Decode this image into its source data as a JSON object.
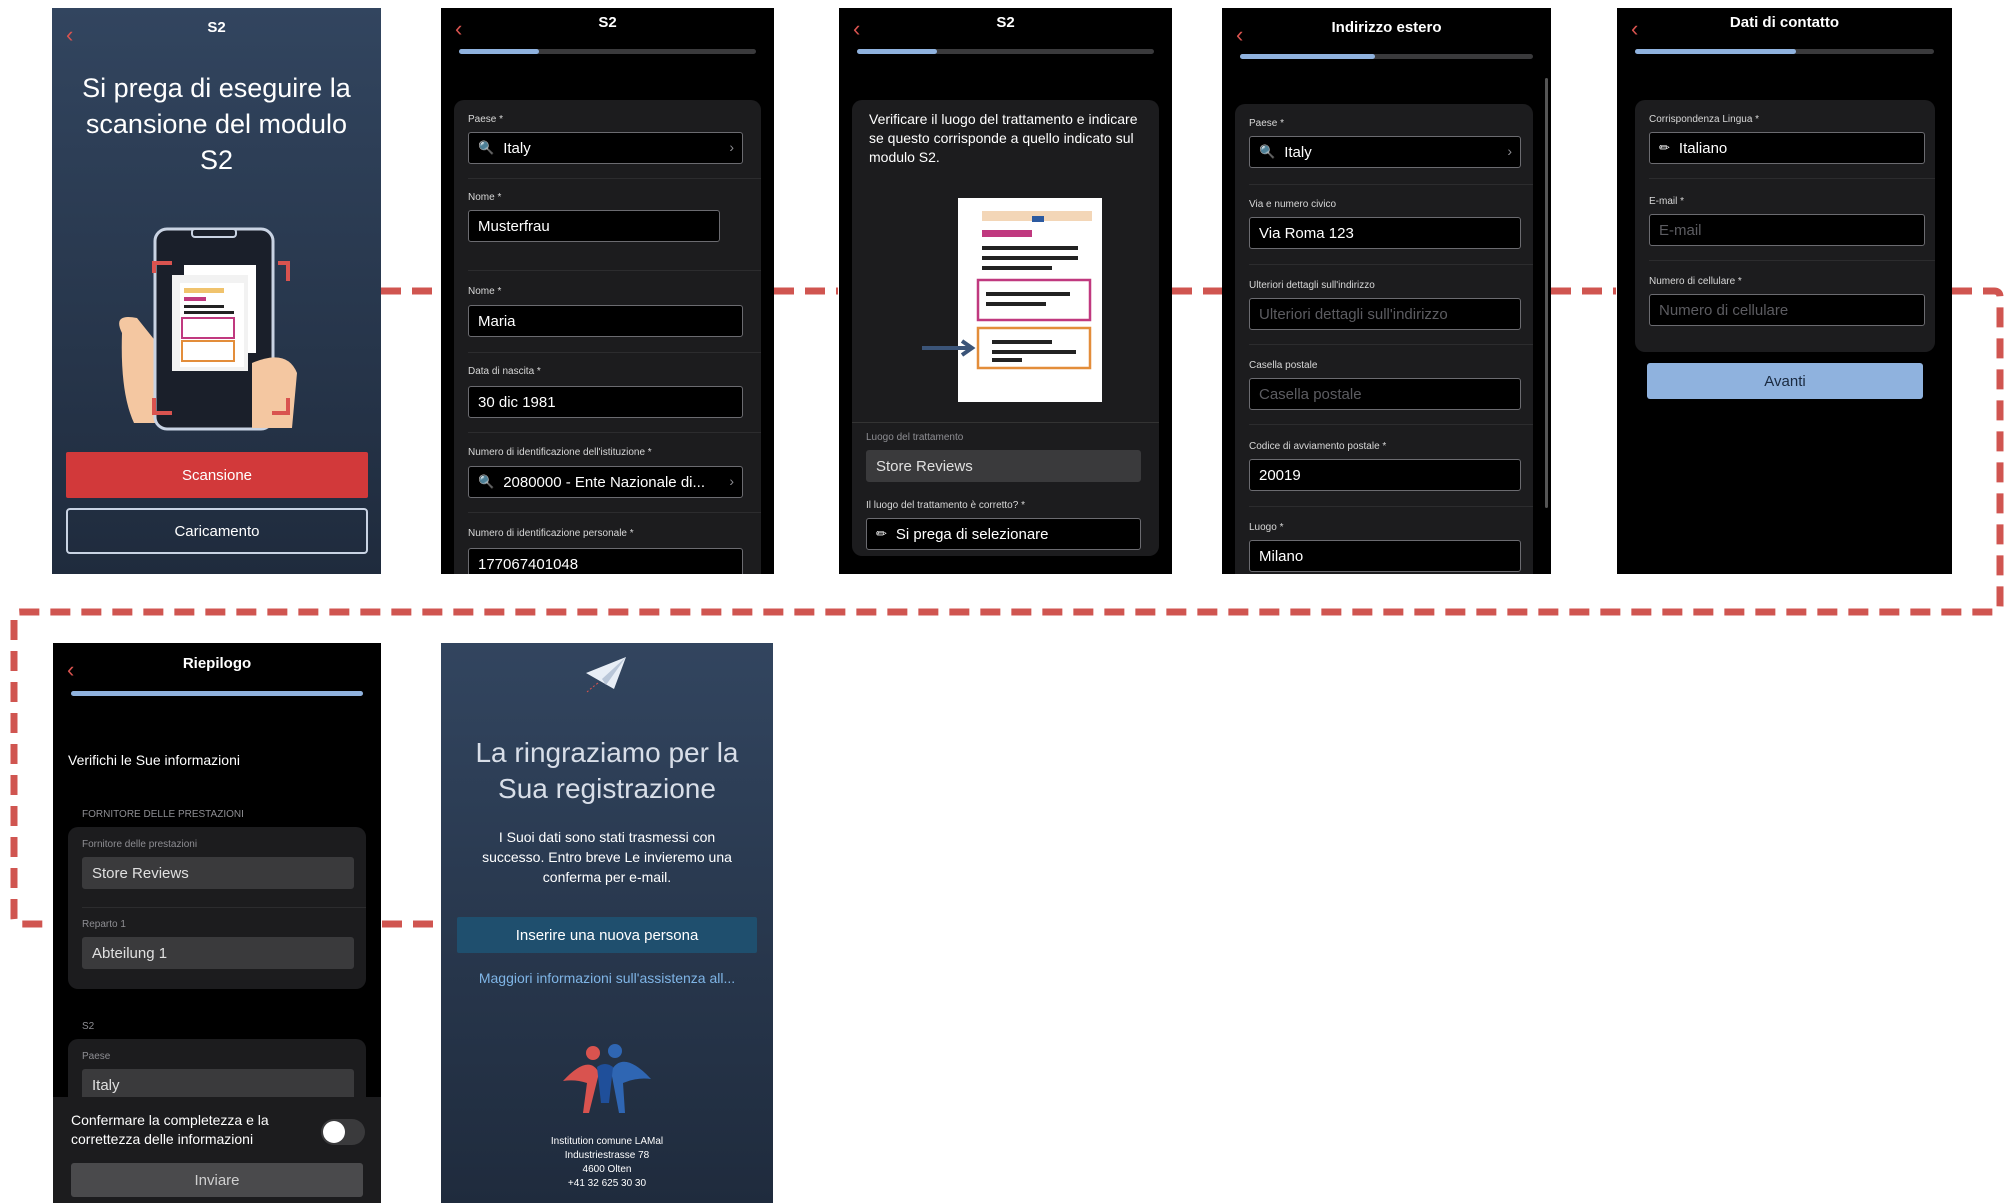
{
  "scan": {
    "title": "S2",
    "heading": "Si prega di eseguire la scansione del modulo S2",
    "scan_button": "Scansione",
    "upload_button": "Caricamento"
  },
  "personal": {
    "title": "S2",
    "progress": 0.27,
    "country_label": "Paese *",
    "country_value": "Italy",
    "lastname_label": "Nome *",
    "lastname_value": "Musterfrau",
    "firstname_label": "Nome *",
    "firstname_value": "Maria",
    "dob_label": "Data di nascita *",
    "dob_value": "30 dic 1981",
    "institution_label": "Numero di identificazione dell'istituzione *",
    "institution_value": "2080000 - Ente Nazionale di...",
    "personal_id_label": "Numero di identificazione personale *",
    "personal_id_value": "177067401048"
  },
  "treatment": {
    "title": "S2",
    "progress": 0.27,
    "instruction": "Verificare il luogo del trattamento e indicare se questo corrisponde a quello indicato sul modulo S2.",
    "place_label": "Luogo del trattamento",
    "place_value": "Store Reviews",
    "correct_label": "Il luogo del trattamento è corretto? *",
    "correct_value": "Si prega di selezionare"
  },
  "address": {
    "title": "Indirizzo estero",
    "progress": 0.46,
    "country_label": "Paese *",
    "country_value": "Italy",
    "street_label": "Via e numero civico",
    "street_value": "Via Roma 123",
    "details_label": "Ulteriori dettagli sull'indirizzo",
    "details_placeholder": "Ulteriori dettagli sull'indirizzo",
    "pobox_label": "Casella postale",
    "pobox_placeholder": "Casella postale",
    "zip_label": "Codice di avviamento postale *",
    "zip_value": "20019",
    "city_label": "Luogo *",
    "city_value": "Milano"
  },
  "contact": {
    "title": "Dati di contatto",
    "progress": 0.54,
    "language_label": "Corrispondenza Lingua *",
    "language_value": "Italiano",
    "email_label": "E-mail *",
    "email_placeholder": "E-mail",
    "phone_label": "Numero di cellulare *",
    "phone_placeholder": "Numero di cellulare",
    "next_button": "Avanti"
  },
  "summary": {
    "title": "Riepilogo",
    "progress": 1.0,
    "heading": "Verifichi le Sue informazioni",
    "provider_section": "FORNITORE DELLE PRESTAZIONI",
    "provider_label": "Fornitore delle prestazioni",
    "provider_value": "Store Reviews",
    "dept_label": "Reparto 1",
    "dept_value": "Abteilung 1",
    "s2_section": "S2",
    "country_label": "Paese",
    "country_value": "Italy",
    "confirm_text": "Confermare la completezza e la correttezza delle informazioni",
    "send_button": "Inviare"
  },
  "thanks": {
    "heading": "La ringraziamo per la Sua registrazione",
    "message": "I Suoi dati sono stati trasmessi con successo. Entro breve Le invieremo una conferma per e-mail.",
    "new_person_button": "Inserire una nuova persona",
    "more_info_link": "Maggiori informazioni sull'assistenza all...",
    "org_name": "Institution comune LAMal",
    "org_street": "Industriestrasse 78",
    "org_city": "4600 Olten",
    "org_phone": "+41 32 625 30 30"
  },
  "colors": {
    "accent_red": "#d9534f",
    "progress_blue": "#8fb2de",
    "button_blue": "#8fb2de",
    "connector": "#d9534f"
  }
}
